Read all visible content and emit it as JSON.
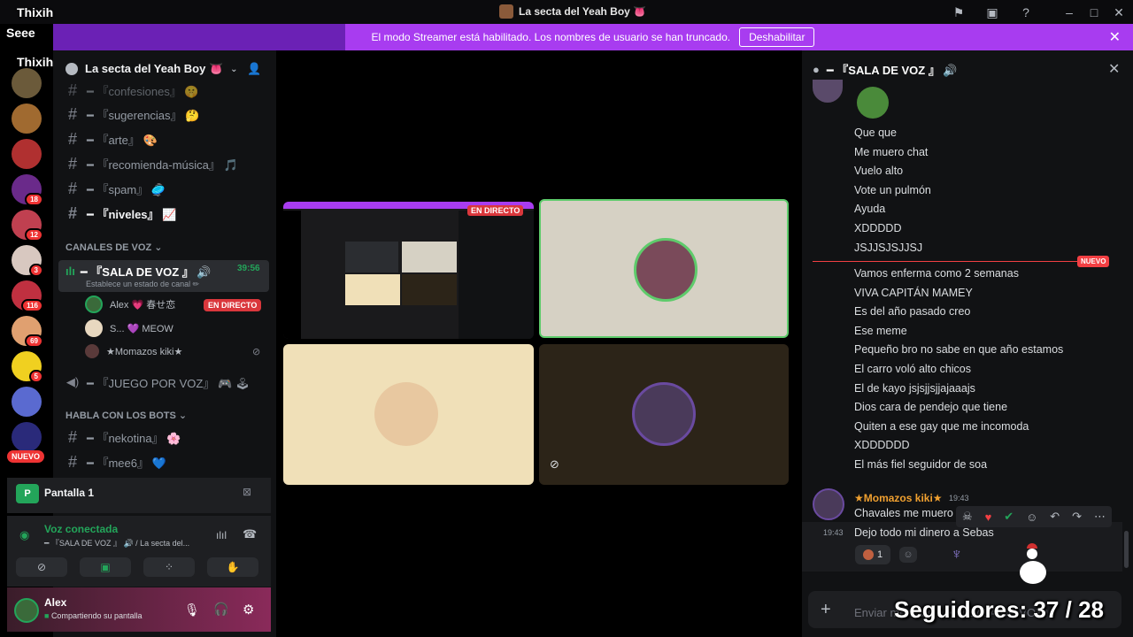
{
  "window": {
    "title": "La secta del Yeah Boy 👅"
  },
  "overlay": {
    "label_top": "Thixih",
    "label_mid": "Seee",
    "label_bottom": "Thixih"
  },
  "banner": {
    "text": "El modo Streamer está habilitado. Los nombres de usuario se han truncado.",
    "button": "Deshabilitar"
  },
  "servers": {
    "badges": [
      "18",
      "12",
      "3",
      "116",
      "69",
      "5"
    ],
    "new_label": "NUEVO"
  },
  "sidebar": {
    "server_name": "La secta del Yeah Boy 👅",
    "channels": [
      {
        "name": "━ 『confesiones』 🤫"
      },
      {
        "name": "━ 『sugerencias』 🤔"
      },
      {
        "name": "━ 『arte』 🎨"
      },
      {
        "name": "━ 『recomienda-música』 🎵"
      },
      {
        "name": "━ 『spam』 🥏"
      },
      {
        "name": "━ 『niveles』 📈"
      }
    ],
    "voice_category": "CANALES DE VOZ",
    "voice_channel": {
      "name": "━ 『SALA DE VOZ 』 🔊",
      "timer": "39:56",
      "status": "Establece un estado de canal ✏"
    },
    "voice_users": [
      {
        "name": "Alex 💗 春せ恋"
      },
      {
        "name": "S... 💜 MEOW"
      },
      {
        "name": "★Momazos kiki★"
      }
    ],
    "live_badge": "EN DIRECTO",
    "voice_channel_2": "━ 『JUEGO POR VOZ』 🎮 🕹",
    "bots_category": "HABLA CON LOS BOTS",
    "bot_channels": [
      {
        "name": "━ 『nekotina』 🌸"
      },
      {
        "name": "━ 『mee6』 💙"
      }
    ]
  },
  "screen_panel": {
    "label": "Pantalla 1"
  },
  "voice_panel": {
    "status": "Voz conectada",
    "location": "━ 『SALA DE VOZ 』 🔊 / La secta del..."
  },
  "user_panel": {
    "name": "Alex",
    "status": "Compartiendo su pantalla"
  },
  "stage": {
    "live_label": "EN DIRECTO"
  },
  "chat": {
    "header": "━ 『SALA DE VOZ 』 🔊",
    "messages_before": [
      "Que que",
      "Me muero chat",
      "Vuelo alto",
      "Vote un pulmón",
      "Ayuda",
      "XDDDDD",
      "JSJJSJSJJSJ"
    ],
    "new_tag": "NUEVO",
    "messages_after": [
      "Vamos enferma como 2 semanas",
      "VIVA CAPITÁN MAMEY",
      "Es del año  pasado creo",
      "Ese meme",
      "Pequeño bro no sabe en que año estamos",
      "El carro voló alto chicos",
      "El de kayo jsjsjjsjjajaaajs",
      "Dios cara de pendejo que tiene",
      "Quiten a ese gay que me incomoda",
      "XDDDDDD",
      "El más fiel seguidor de soa"
    ],
    "last_author": "★Momazos kiki★",
    "last_author_time": "19:43",
    "last_msg_1": "Chavales me muero",
    "last_msg_time": "19:43",
    "last_msg_2": "Dejo todo mi dinero a Sebas",
    "reaction_count": "1",
    "input_placeholder": "Enviar mensaje a ━ 『SALA DE VOZ』"
  },
  "followers": "Seguidores: 37 / 28",
  "colors": {
    "banner": "#a83cf0",
    "live": "#da373c",
    "online": "#23a55a",
    "new_line": "#f23f43"
  }
}
